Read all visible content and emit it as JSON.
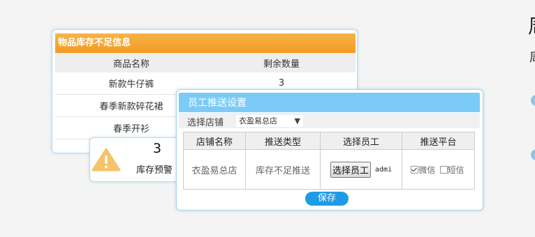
{
  "edge": {
    "big_glyph": "周",
    "small_glyph": "周"
  },
  "stock_panel": {
    "title": "物品库存不足信息",
    "columns": [
      "商品名称",
      "剩余数量"
    ],
    "rows": [
      {
        "name": "新款牛仔裤",
        "qty": "3"
      },
      {
        "name": "春季新款碎花裙",
        "qty": ""
      },
      {
        "name": "春季开衫",
        "qty": ""
      }
    ]
  },
  "warning": {
    "count": "3",
    "label": "库存预警",
    "icon": "warning-triangle-icon",
    "icon_color": "#f5c36a"
  },
  "push_panel": {
    "title": "员工推送设置",
    "store_label": "选择店铺",
    "store_selected": "衣盈易总店",
    "columns": [
      "店铺名称",
      "推送类型",
      "选择员工",
      "推送平台"
    ],
    "row": {
      "store": "衣盈易总店",
      "type": "库存不足推送",
      "choose_button": "选择员工",
      "employee": "admi",
      "platforms": [
        {
          "label": "微信",
          "checked": true
        },
        {
          "label": "短信",
          "checked": false
        }
      ]
    },
    "save_label": "保存"
  },
  "colors": {
    "stock_header": "#f5a83a",
    "push_header": "#7ccbf7",
    "save_button": "#1e9be6",
    "panel_border": "#b6dbf2"
  }
}
